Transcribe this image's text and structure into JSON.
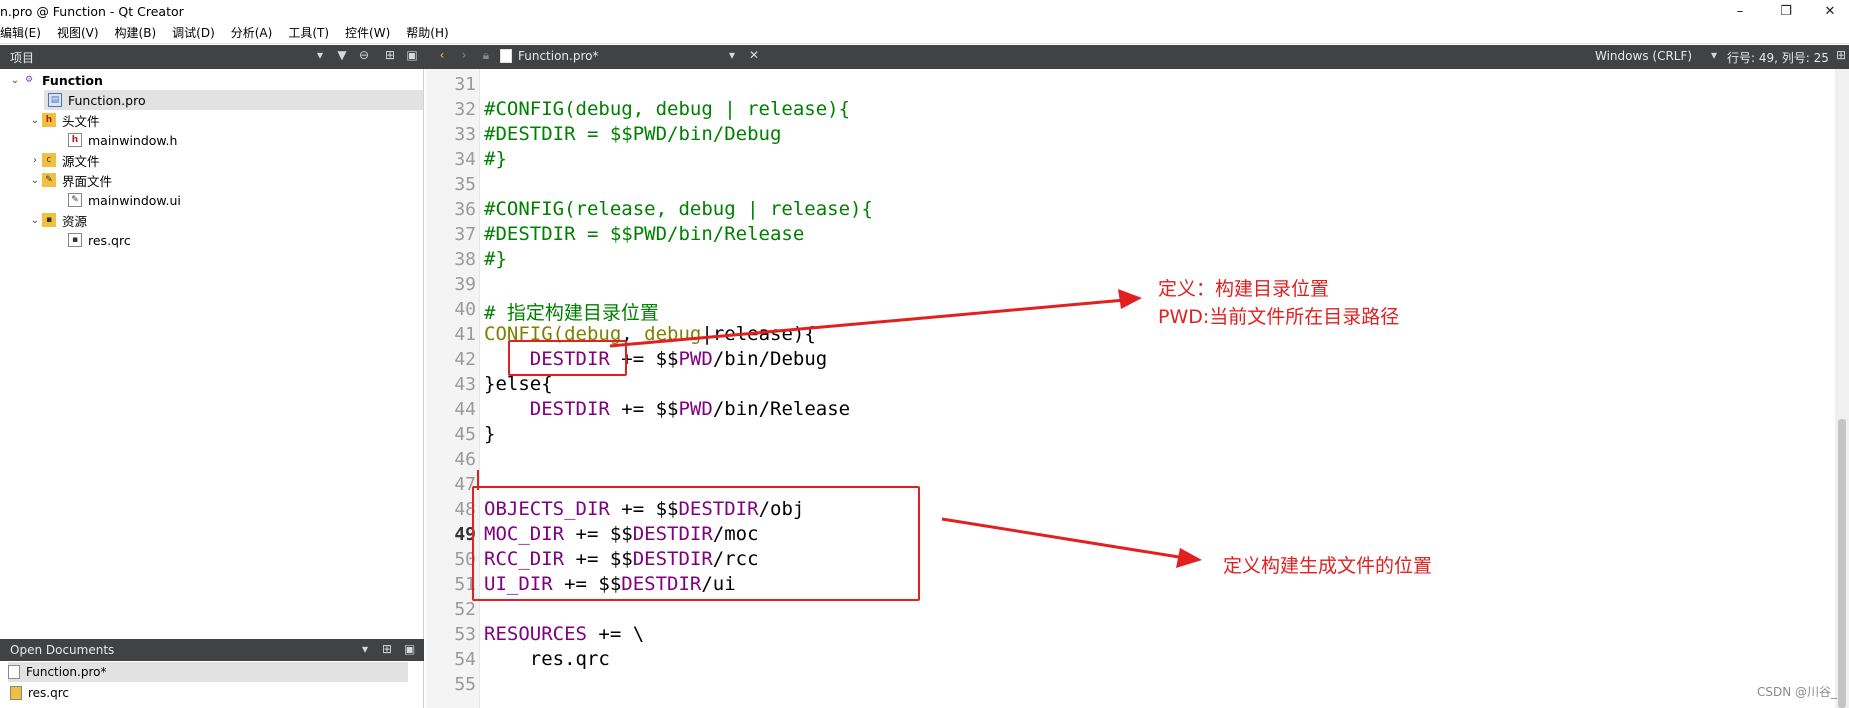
{
  "window": {
    "title": "n.pro @ Function - Qt Creator",
    "controls": [
      "–",
      "❐",
      "✕"
    ]
  },
  "menu": [
    "编辑(E)",
    "视图(V)",
    "构建(B)",
    "调试(D)",
    "分析(A)",
    "工具(T)",
    "控件(W)",
    "帮助(H)"
  ],
  "toolbar": {
    "projects_label": "项目",
    "open_file": "Function.pro*",
    "line_ending": "Windows (CRLF)",
    "position": "行号: 49, 列号: 25"
  },
  "tree": {
    "root": "Function",
    "pro_file": "Function.pro",
    "headers": "头文件",
    "header_file": "mainwindow.h",
    "sources": "源文件",
    "forms": "界面文件",
    "form_file": "mainwindow.ui",
    "resources": "资源",
    "resource_file": "res.qrc"
  },
  "open_documents": {
    "label": "Open Documents",
    "items": [
      "Function.pro*",
      "res.qrc"
    ]
  },
  "editor": {
    "lines": [
      {
        "n": "31",
        "segments": []
      },
      {
        "n": "32",
        "segments": [
          {
            "t": "#CONFIG(debug, debug | release){",
            "c": "com"
          }
        ]
      },
      {
        "n": "33",
        "segments": [
          {
            "t": "#DESTDIR = $$PWD/bin/Debug",
            "c": "com"
          }
        ]
      },
      {
        "n": "34",
        "segments": [
          {
            "t": "#}",
            "c": "com"
          }
        ]
      },
      {
        "n": "35",
        "segments": []
      },
      {
        "n": "36",
        "segments": [
          {
            "t": "#CONFIG(release, debug | release){",
            "c": "com"
          }
        ]
      },
      {
        "n": "37",
        "segments": [
          {
            "t": "#DESTDIR = $$PWD/bin/Release",
            "c": "com"
          }
        ]
      },
      {
        "n": "38",
        "segments": [
          {
            "t": "#}",
            "c": "com"
          }
        ]
      },
      {
        "n": "39",
        "segments": []
      },
      {
        "n": "40",
        "segments": [
          {
            "t": "# 指定构建目录位置",
            "c": "com"
          }
        ]
      },
      {
        "n": "41",
        "segments": [
          {
            "t": "CONFIG(",
            "c": "cond"
          },
          {
            "t": "debug",
            "c": "cond"
          },
          {
            "t": ", ",
            "c": ""
          },
          {
            "t": "debug",
            "c": "cond"
          },
          {
            "t": "|release){",
            "c": ""
          }
        ]
      },
      {
        "n": "42",
        "segments": [
          {
            "t": "    ",
            "c": ""
          },
          {
            "t": "DESTDIR",
            "c": "var"
          },
          {
            "t": " += $$",
            "c": ""
          },
          {
            "t": "PWD",
            "c": "var"
          },
          {
            "t": "/bin/Debug",
            "c": ""
          }
        ]
      },
      {
        "n": "43",
        "segments": [
          {
            "t": "}else{",
            "c": ""
          }
        ]
      },
      {
        "n": "44",
        "segments": [
          {
            "t": "    ",
            "c": ""
          },
          {
            "t": "DESTDIR",
            "c": "var"
          },
          {
            "t": " += $$",
            "c": ""
          },
          {
            "t": "PWD",
            "c": "var"
          },
          {
            "t": "/bin/Release",
            "c": ""
          }
        ]
      },
      {
        "n": "45",
        "segments": [
          {
            "t": "}",
            "c": ""
          }
        ]
      },
      {
        "n": "46",
        "segments": []
      },
      {
        "n": "47",
        "segments": []
      },
      {
        "n": "48",
        "segments": [
          {
            "t": "OBJECTS_DIR",
            "c": "var"
          },
          {
            "t": " += $$",
            "c": ""
          },
          {
            "t": "DESTDIR",
            "c": "var"
          },
          {
            "t": "/obj",
            "c": ""
          }
        ]
      },
      {
        "n": "49",
        "segments": [
          {
            "t": "MOC_DIR",
            "c": "var"
          },
          {
            "t": " += $$",
            "c": ""
          },
          {
            "t": "DESTDIR",
            "c": "var"
          },
          {
            "t": "/moc",
            "c": ""
          }
        ]
      },
      {
        "n": "50",
        "segments": [
          {
            "t": "RCC_DIR",
            "c": "var"
          },
          {
            "t": " += $$",
            "c": ""
          },
          {
            "t": "DESTDIR",
            "c": "var"
          },
          {
            "t": "/rcc",
            "c": ""
          }
        ]
      },
      {
        "n": "51",
        "segments": [
          {
            "t": "UI_DIR",
            "c": "var"
          },
          {
            "t": " += $$",
            "c": ""
          },
          {
            "t": "DESTDIR",
            "c": "var"
          },
          {
            "t": "/ui",
            "c": ""
          }
        ]
      },
      {
        "n": "52",
        "segments": []
      },
      {
        "n": "53",
        "segments": [
          {
            "t": "RESOURCES",
            "c": "var"
          },
          {
            "t": " += \\",
            "c": ""
          }
        ]
      },
      {
        "n": "54",
        "segments": [
          {
            "t": "    res.qrc",
            "c": ""
          }
        ]
      },
      {
        "n": "55",
        "segments": []
      }
    ],
    "current_line": "49"
  },
  "annotations": {
    "note1_line1": "定义：构建目录位置",
    "note1_line2": "PWD:当前文件所在目录路径",
    "note2": "定义构建生成文件的位置",
    "color": "#e32020"
  },
  "watermark": "CSDN @川谷_"
}
